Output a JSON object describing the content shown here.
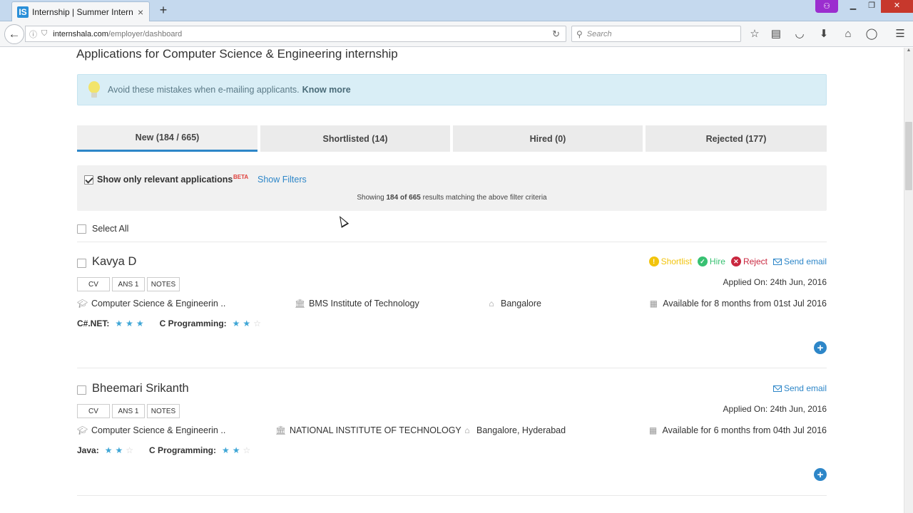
{
  "browser": {
    "tab_title": "Internship | Summer Intern...",
    "tab_favicon": "IS",
    "tab_close": "×",
    "new_tab": "+",
    "private_icon": "mask-icon",
    "url_domain": "internshala.com",
    "url_path": "/employer/dashboard",
    "search_placeholder": "Search",
    "toolbar_icons": [
      "star-icon",
      "reading-list-icon",
      "pocket-icon",
      "download-icon",
      "home-icon",
      "chat-icon",
      "menu-icon"
    ]
  },
  "page": {
    "title": "Applications for Computer Science & Engineering internship",
    "alert_text": "Avoid these mistakes when e-mailing applicants.",
    "alert_link": "Know more",
    "tabs": [
      {
        "label": "New (184 / 665)"
      },
      {
        "label": "Shortlisted (14)"
      },
      {
        "label": "Hired (0)"
      },
      {
        "label": "Rejected (177)"
      }
    ],
    "filter_label": "Show only relevant applications",
    "beta_badge": "BETA",
    "show_filters": "Show Filters",
    "showing_prefix": "Showing",
    "showing_count": "184 of 665",
    "showing_suffix": "results matching the above filter criteria",
    "select_all": "Select All"
  },
  "action_labels": {
    "shortlist": "Shortlist",
    "hire": "Hire",
    "reject": "Reject",
    "send_email": "Send email"
  },
  "applicants": [
    {
      "name": "Kavya D",
      "buttons": [
        "CV",
        "ANS 1",
        "NOTES"
      ],
      "applied_on": "Applied On: 24th Jun, 2016",
      "degree": "Computer Science & Engineerin ..",
      "college": "BMS Institute of Technology",
      "location": "Bangalore",
      "availability": "Available for 8 months from 01st Jul 2016",
      "skills": [
        {
          "name": "C#.NET:",
          "rating": 3,
          "max": 3
        },
        {
          "name": "C Programming:",
          "rating": 2,
          "max": 3
        }
      ],
      "show_actions": true
    },
    {
      "name": "Bheemari Srikanth",
      "buttons": [
        "CV",
        "ANS 1",
        "NOTES"
      ],
      "applied_on": "Applied On: 24th Jun, 2016",
      "degree": "Computer Science & Engineerin ..",
      "college": "NATIONAL INSTITUTE OF TECHNOLOGY",
      "location": "Bangalore, Hyderabad",
      "availability": "Available for 6 months from 04th Jul 2016",
      "skills": [
        {
          "name": "Java:",
          "rating": 2,
          "max": 3
        },
        {
          "name": "C Programming:",
          "rating": 2,
          "max": 3
        }
      ],
      "show_actions": false
    }
  ]
}
